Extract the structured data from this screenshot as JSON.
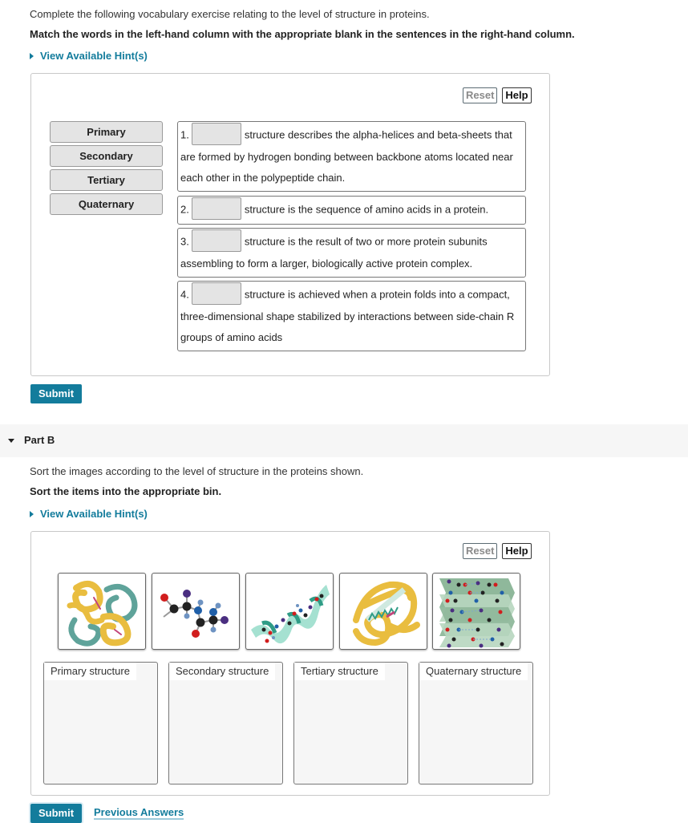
{
  "part_a": {
    "intro": "Complete the following vocabulary exercise relating to the level of structure in proteins.",
    "instruction": "Match the words in the left-hand column with the appropriate blank in the sentences in the right-hand column.",
    "hint_label": "View Available Hint(s)",
    "reset_label": "Reset",
    "help_label": "Help",
    "word_bank": [
      "Primary",
      "Secondary",
      "Tertiary",
      "Quaternary"
    ],
    "sentences": [
      {
        "number": "1.",
        "blank_value": "",
        "text": "structure describes the alpha-helices and beta-sheets that are formed by hydrogen bonding between backbone atoms located near each other in the polypeptide chain."
      },
      {
        "number": "2.",
        "blank_value": "",
        "text": "structure is the sequence of amino acids in a protein."
      },
      {
        "number": "3.",
        "blank_value": "",
        "text": "structure is the result of two or more protein subunits assembling to form a larger, biologically active protein complex."
      },
      {
        "number": "4.",
        "blank_value": "",
        "text": "structure is achieved when a protein folds into a compact, three-dimensional shape stabilized by interactions between side-chain R groups of amino acids"
      }
    ],
    "submit_label": "Submit"
  },
  "part_b": {
    "title": "Part B",
    "intro": "Sort the images according to the level of structure in the proteins shown.",
    "instruction": "Sort the items into the appropriate bin.",
    "hint_label": "View Available Hint(s)",
    "reset_label": "Reset",
    "help_label": "Help",
    "items": [
      {
        "image": "quaternary-protein-complex-image"
      },
      {
        "image": "amino-acid-ball-and-stick-image"
      },
      {
        "image": "alpha-helix-ribbon-image"
      },
      {
        "image": "folded-tertiary-protein-image"
      },
      {
        "image": "beta-pleated-sheet-image"
      }
    ],
    "bins": [
      "Primary structure",
      "Secondary structure",
      "Tertiary structure",
      "Quaternary structure"
    ],
    "submit_label": "Submit",
    "previous_answers_label": "Previous Answers"
  },
  "colors": {
    "accent": "#137c9c",
    "tile_gray": "#e4e4e4",
    "part_bar": "#f6f6f6"
  }
}
